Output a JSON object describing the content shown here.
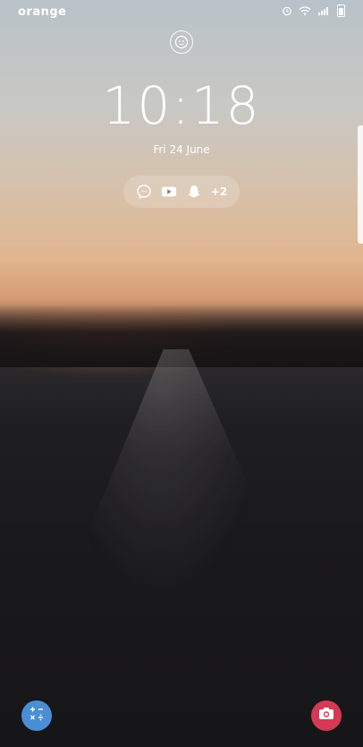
{
  "status_bar": {
    "carrier": "orange",
    "icons": [
      "alarm-icon",
      "wifi-icon",
      "signal-icon",
      "battery-icon"
    ]
  },
  "lock_screen": {
    "owner_icon": "face-icon",
    "time": "10:18",
    "date": "Fri 24 June",
    "notifications": {
      "apps": [
        "messenger-icon",
        "youtube-icon",
        "snapchat-icon"
      ],
      "more_count": "+2"
    },
    "shortcuts": {
      "left": "calculator-icon",
      "right": "camera-icon"
    }
  },
  "colors": {
    "calculator_bg": "#4a8fd6",
    "camera_bg": "#d43a55"
  }
}
